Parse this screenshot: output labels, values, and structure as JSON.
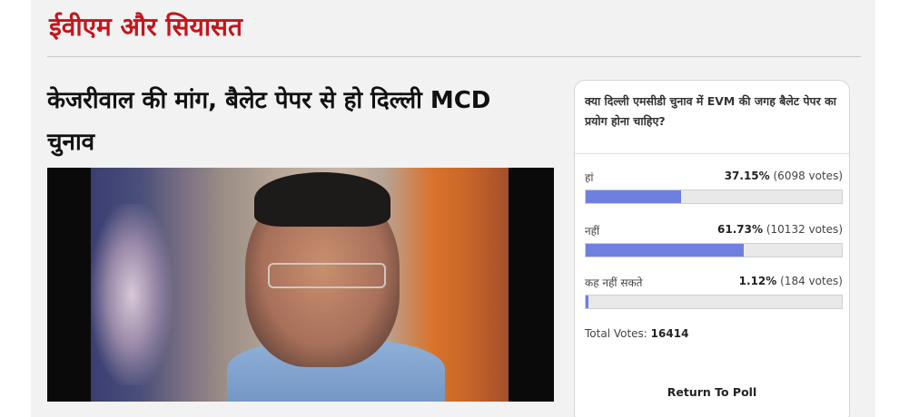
{
  "section": {
    "title": "ईवीएम और सियासत"
  },
  "article": {
    "headline": "केजरीवाल की मांग, बैलेट पेपर से हो दिल्ली MCD चुनाव"
  },
  "poll": {
    "question": "क्या दिल्ली एमसीडी चुनाव में EVM की जगह बैलेट पेपर का प्रयोग होना चाहिए?",
    "options": [
      {
        "label": "हां",
        "percent_text": "37.15%",
        "votes_text": "(6098 votes)",
        "fraction": 0.3715
      },
      {
        "label": "नहीं",
        "percent_text": "61.73%",
        "votes_text": "(10132 votes)",
        "fraction": 0.6173
      },
      {
        "label": "कह नहीं सकते",
        "percent_text": "1.12%",
        "votes_text": "(184 votes)",
        "fraction": 0.0112
      }
    ],
    "total_label": "Total Votes:",
    "total_value": "16414",
    "return_label": "Return To Poll",
    "bar_color": "#6f7fe0"
  },
  "colors": {
    "section_title": "#c0171d"
  }
}
